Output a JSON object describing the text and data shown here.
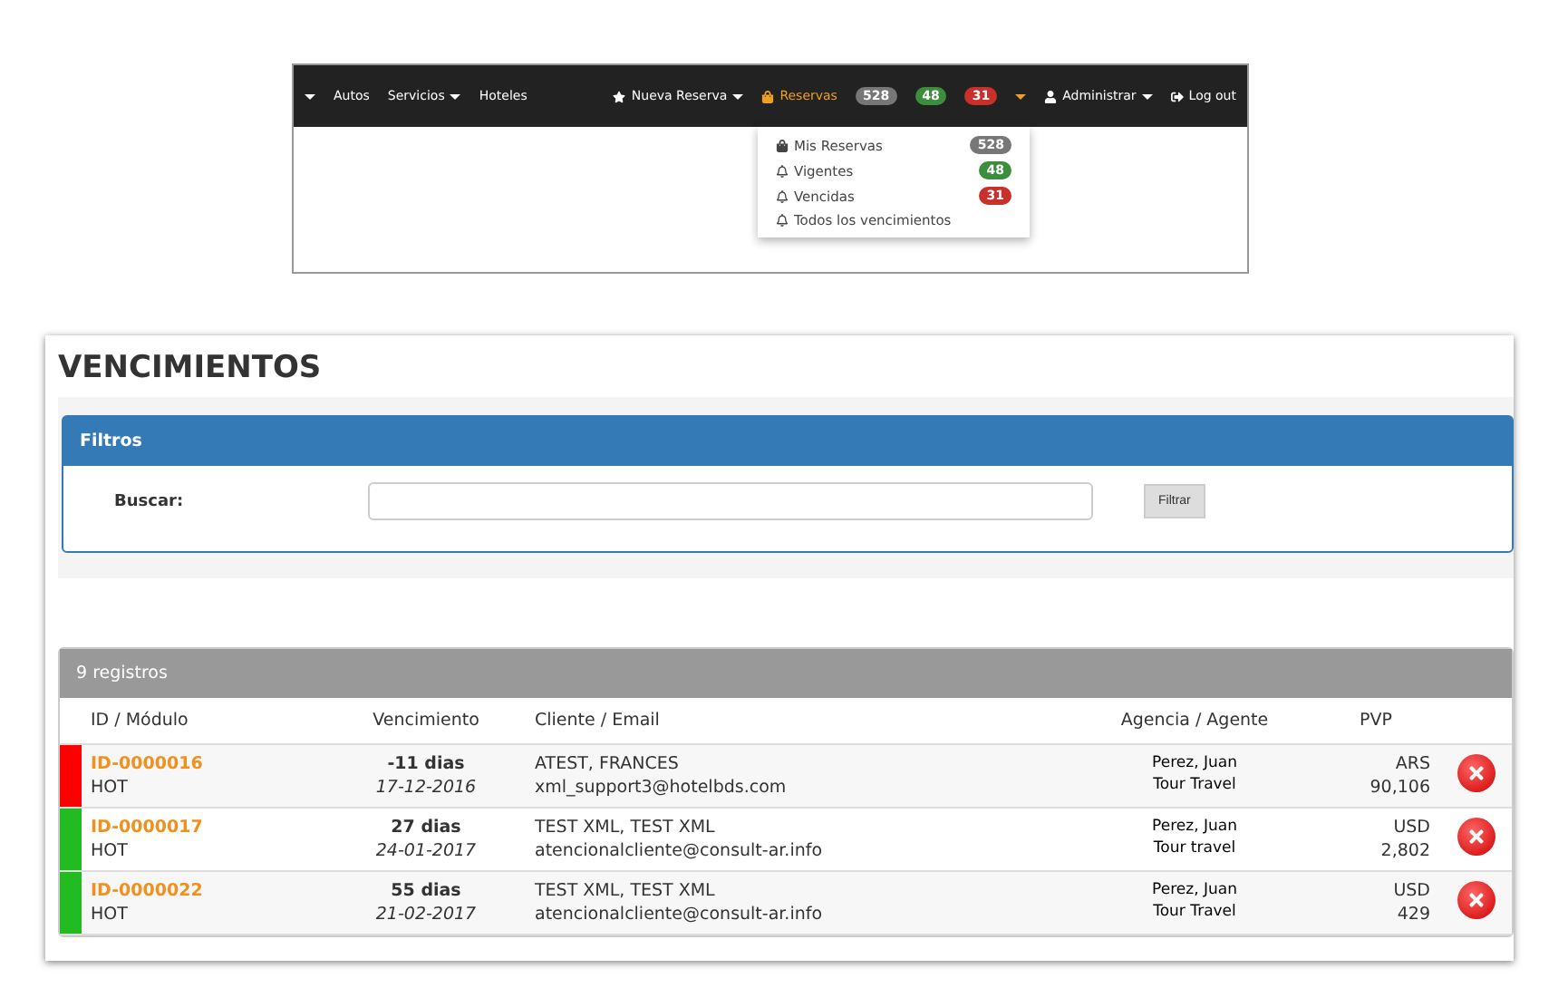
{
  "navbar": {
    "left_items": [
      {
        "label": "Autos",
        "caret": false
      },
      {
        "label": "Servicios",
        "caret": true
      },
      {
        "label": "Hoteles",
        "caret": false
      }
    ],
    "right_items": [
      {
        "kind": "star",
        "label": "Nueva Reserva",
        "caret": true,
        "active": false
      },
      {
        "kind": "bag",
        "label": "Reservas",
        "caret": true,
        "active": true,
        "badges": [
          {
            "text": "528",
            "color": "#777777"
          },
          {
            "text": "48",
            "color": "#3c8d3c"
          },
          {
            "text": "31",
            "color": "#c9302c"
          }
        ]
      },
      {
        "kind": "user",
        "label": "Administrar",
        "caret": true,
        "active": false
      },
      {
        "kind": "logout",
        "label": "Log out",
        "caret": false,
        "active": false
      }
    ]
  },
  "dropdown": [
    {
      "kind": "bag",
      "label": "Mis Reservas",
      "badge": {
        "text": "528",
        "color": "#777777"
      }
    },
    {
      "kind": "bell",
      "label": "Vigentes",
      "badge": {
        "text": "48",
        "color": "#3c8d3c"
      }
    },
    {
      "kind": "bell",
      "label": "Vencidas",
      "badge": {
        "text": "31",
        "color": "#c9302c"
      }
    },
    {
      "kind": "bell",
      "label": "Todos los vencimientos"
    }
  ],
  "page_title": "VENCIMIENTOS",
  "filters": {
    "title": "Filtros",
    "label": "Buscar:",
    "button": "Filtrar"
  },
  "table": {
    "count": "9 registros",
    "columns": [
      "ID / Módulo",
      "Vencimiento",
      "Cliente / Email",
      "Agencia / Agente",
      "PVP"
    ],
    "rows": [
      {
        "color": "#ff0000",
        "id": "ID-0000016",
        "module": "HOT",
        "days": "-11 dias",
        "date": "17-12-2016",
        "client": "ATEST, FRANCES",
        "email": "xml_support3@hotelbds.com",
        "agent": "Perez, Juan",
        "agency": "Tour Travel",
        "currency": "ARS",
        "amount": "90,106"
      },
      {
        "color": "#22bb22",
        "id": "ID-0000017",
        "module": "HOT",
        "days": "27 dias",
        "date": "24-01-2017",
        "client": "TEST XML, TEST XML",
        "email": "atencionalcliente@consult-ar.info",
        "agent": "Perez, Juan",
        "agency": "Tour travel",
        "currency": "USD",
        "amount": "2,802"
      },
      {
        "color": "#22bb22",
        "id": "ID-0000022",
        "module": "HOT",
        "days": "55 dias",
        "date": "21-02-2017",
        "client": "TEST XML, TEST XML",
        "email": "atencionalcliente@consult-ar.info",
        "agent": "Perez, Juan",
        "agency": "Tour Travel",
        "currency": "USD",
        "amount": "429"
      }
    ]
  }
}
